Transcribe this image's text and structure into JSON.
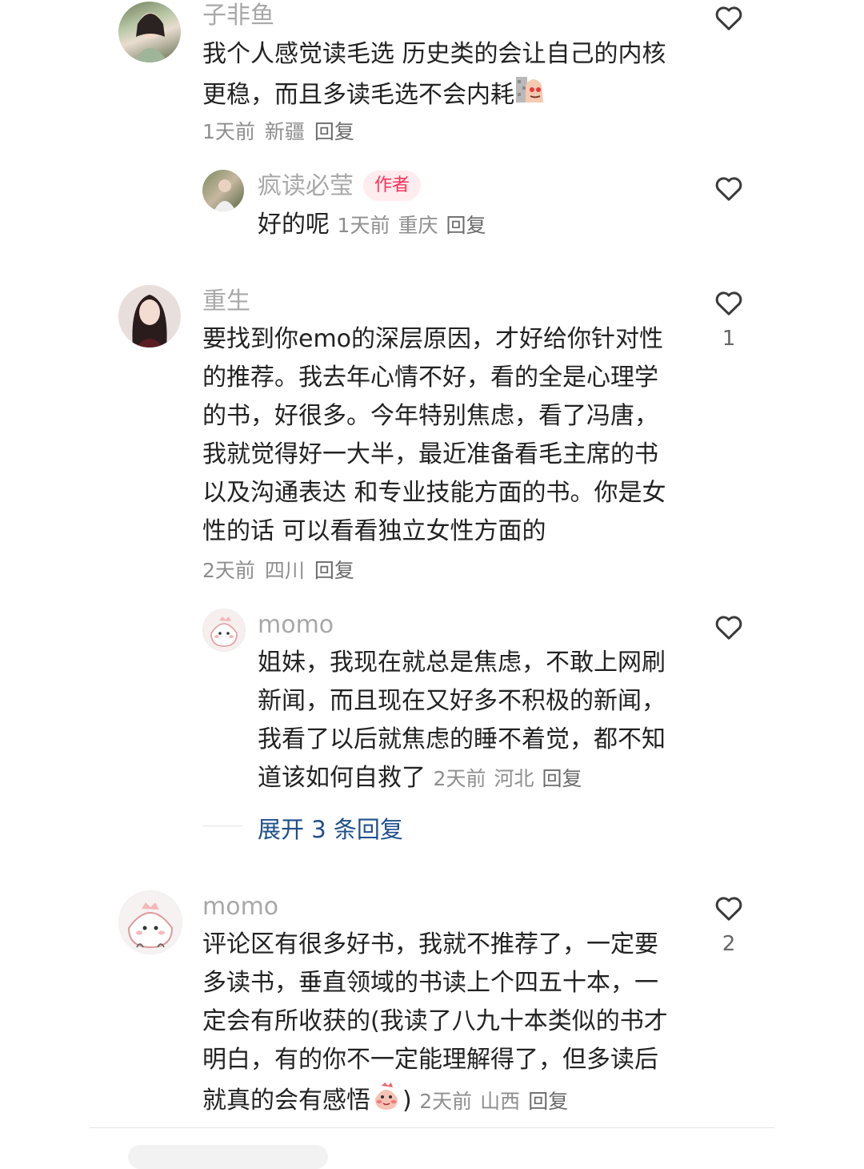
{
  "comments": [
    {
      "username": "子非鱼",
      "text_line1": "我个人感觉读毛选 历史类的会让自己的内核",
      "text_line2": "更稳，而且多读毛选不会内耗",
      "time": "1天前",
      "location": "新疆",
      "reply_label": "回复",
      "reply": {
        "username": "疯读必莹",
        "badge": "作者",
        "text": "好的呢",
        "time": "1天前",
        "location": "重庆",
        "reply_label": "回复"
      }
    },
    {
      "username": "重生",
      "lines": [
        "要找到你emo的深层原因，才好给你针对性",
        "的推荐。我去年心情不好，看的全是心理学",
        "的书，好很多。今年特别焦虑，看了冯唐，",
        "我就觉得好一大半，最近准备看毛主席的书",
        "以及沟通表达 和专业技能方面的书。你是女",
        "性的话 可以看看独立女性方面的"
      ],
      "like_count": "1",
      "time": "2天前",
      "location": "四川",
      "reply_label": "回复",
      "reply": {
        "username": "momo",
        "lines": [
          "姐妹，我现在就总是焦虑，不敢上网刷",
          "新闻，而且现在又好多不积极的新闻，",
          "我看了以后就焦虑的睡不着觉，都不知",
          "道该如何自救了"
        ],
        "time": "2天前",
        "location": "河北",
        "reply_label": "回复"
      },
      "expand_label": "展开 3 条回复"
    },
    {
      "username": "momo",
      "lines": [
        "评论区有很多好书，我就不推荐了，一定要",
        "多读书，垂直领域的书读上个四五十本，一",
        "定会有所收获的(我读了八九十本类似的书才",
        "明白，有的你不一定能理解得了，但多读后",
        "就真的会有感悟"
      ],
      "line5_suffix": ")",
      "like_count": "2",
      "time": "2天前",
      "location": "山西",
      "reply_label": "回复"
    }
  ],
  "icons": {
    "like": "heart-outline-icon",
    "emoji_wall": "peeking-face-emoji",
    "emoji_blush": "blushing-face-emoji"
  },
  "colors": {
    "author_badge_bg": "#ffecef",
    "author_badge_text": "#ff2f54",
    "expand_link": "#1f4f8a"
  }
}
